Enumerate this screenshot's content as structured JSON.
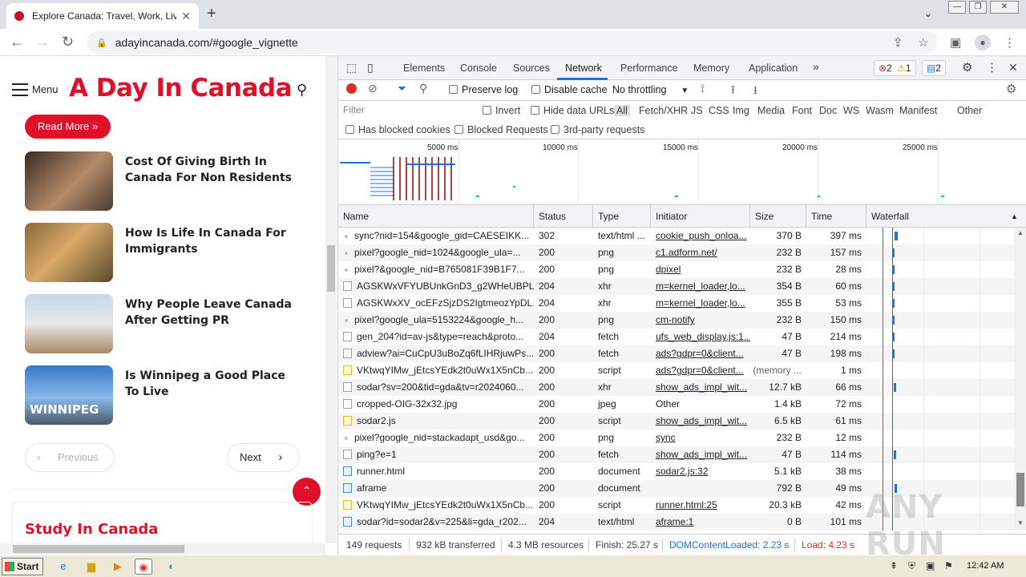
{
  "browser": {
    "tab_title": "Explore Canada: Travel, Work, Live,",
    "url": "adayincanada.com/#google_vignette",
    "new_tab": "+"
  },
  "site": {
    "menu_label": "Menu",
    "title": "A Day In Canada",
    "read_more": "Read More »",
    "posts": [
      {
        "title": "Cost Of Giving Birth In Canada For Non Residents"
      },
      {
        "title": "How Is Life In Canada For Immigrants"
      },
      {
        "title": "Why People Leave Canada After Getting PR"
      },
      {
        "title": "Is Winnipeg a Good Place To Live"
      }
    ],
    "thumb_caption": "WINNIPEG",
    "previous": "Previous",
    "next": "Next",
    "section_title": "Study In Canada"
  },
  "devtools": {
    "tabs": [
      "Elements",
      "Console",
      "Sources",
      "Network",
      "Performance",
      "Memory",
      "Application"
    ],
    "active_tab": "Network",
    "errors": "2",
    "warnings": "1",
    "messages": "2",
    "controls": {
      "preserve_log": "Preserve log",
      "disable_cache": "Disable cache",
      "throttling": "No throttling"
    },
    "filter": {
      "placeholder": "Filter",
      "invert": "Invert",
      "hide_data_urls": "Hide data URLs",
      "types": [
        "All",
        "Fetch/XHR",
        "JS",
        "CSS",
        "Img",
        "Media",
        "Font",
        "Doc",
        "WS",
        "Wasm",
        "Manifest",
        "Other"
      ],
      "has_blocked_cookies": "Has blocked cookies",
      "blocked_requests": "Blocked Requests",
      "third_party": "3rd-party requests"
    },
    "overview_ticks": [
      "5000 ms",
      "10000 ms",
      "15000 ms",
      "20000 ms",
      "25000 ms"
    ],
    "columns": [
      "Name",
      "Status",
      "Type",
      "Initiator",
      "Size",
      "Time",
      "Waterfall"
    ],
    "requests": [
      {
        "icon": "img",
        "name": "sync?nid=154&google_gid=CAESEIKK...",
        "status": "302",
        "type": "text/html ...",
        "initiator": "cookie_push_onloa...",
        "size": "370 B",
        "time": "397 ms"
      },
      {
        "icon": "img",
        "name": "pixel?google_nid=1024&google_ula=...",
        "status": "200",
        "type": "png",
        "initiator": "c1.adform.net/",
        "size": "232 B",
        "time": "157 ms"
      },
      {
        "icon": "img",
        "name": "pixel?&google_nid=B765081F39B1F7...",
        "status": "200",
        "type": "png",
        "initiator": "dpixel",
        "size": "232 B",
        "time": "28 ms"
      },
      {
        "icon": "box",
        "name": "AGSKWxVFYUBUnkGnD3_g2WHeUBPL...",
        "status": "204",
        "type": "xhr",
        "initiator": "m=kernel_loader,lo...",
        "size": "354 B",
        "time": "60 ms"
      },
      {
        "icon": "box",
        "name": "AGSKWxXV_ocEFzSjzDS2IgtmeozYpDL...",
        "status": "204",
        "type": "xhr",
        "initiator": "m=kernel_loader,lo...",
        "size": "355 B",
        "time": "53 ms"
      },
      {
        "icon": "img",
        "name": "pixel?google_ula=5153224&google_h...",
        "status": "200",
        "type": "png",
        "initiator": "cm-notify",
        "size": "232 B",
        "time": "150 ms"
      },
      {
        "icon": "box",
        "name": "gen_204?id=av-js&type=reach&proto...",
        "status": "204",
        "type": "fetch",
        "initiator": "ufs_web_display.js:1...",
        "size": "47 B",
        "time": "214 ms"
      },
      {
        "icon": "box",
        "name": "adview?ai=CuCpU3uBoZq6fLIHRjuwPs...",
        "status": "200",
        "type": "fetch",
        "initiator": "ads?gdpr=0&client...",
        "size": "47 B",
        "time": "198 ms"
      },
      {
        "icon": "scr",
        "name": "VKtwqYIMw_jEtcsYEdk2t0uWx1X5nCb...",
        "status": "200",
        "type": "script",
        "initiator": "ads?gdpr=0&client...",
        "size": "(memory ...",
        "time": "1 ms"
      },
      {
        "icon": "box",
        "name": "sodar?sv=200&tid=gda&tv=r2024060...",
        "status": "200",
        "type": "xhr",
        "initiator": "show_ads_impl_wit...",
        "size": "12.7 kB",
        "time": "66 ms"
      },
      {
        "icon": "box",
        "name": "cropped-OIG-32x32.jpg",
        "status": "200",
        "type": "jpeg",
        "initiator": "Other",
        "size": "1.4 kB",
        "time": "72 ms"
      },
      {
        "icon": "scr",
        "name": "sodar2.js",
        "status": "200",
        "type": "script",
        "initiator": "show_ads_impl_wit...",
        "size": "6.5 kB",
        "time": "61 ms"
      },
      {
        "icon": "img",
        "name": "pixel?google_nid=stackadapt_usd&go...",
        "status": "200",
        "type": "png",
        "initiator": "sync",
        "size": "232 B",
        "time": "12 ms"
      },
      {
        "icon": "box",
        "name": "ping?e=1",
        "status": "200",
        "type": "fetch",
        "initiator": "show_ads_impl_wit...",
        "size": "47 B",
        "time": "114 ms"
      },
      {
        "icon": "doc",
        "name": "runner.html",
        "status": "200",
        "type": "document",
        "initiator": "sodar2.js:32",
        "size": "5.1 kB",
        "time": "38 ms"
      },
      {
        "icon": "doc",
        "name": "aframe",
        "status": "200",
        "type": "document",
        "initiator": "",
        "size": "792 B",
        "time": "49 ms"
      },
      {
        "icon": "scr",
        "name": "VKtwqYIMw_jEtcsYEdk2t0uWx1X5nCb...",
        "status": "200",
        "type": "script",
        "initiator": "runner.html:25",
        "size": "20.3 kB",
        "time": "42 ms"
      },
      {
        "icon": "doc",
        "name": "sodar?id=sodar2&v=225&li=gda_r202...",
        "status": "204",
        "type": "text/html",
        "initiator": "aframe:1",
        "size": "0 B",
        "time": "101 ms"
      }
    ],
    "status": {
      "requests": "149 requests",
      "transferred": "932 kB transferred",
      "resources": "4.3 MB resources",
      "finish": "Finish: 25.27 s",
      "dcl": "DOMContentLoaded: 2.23 s",
      "load": "Load: 4.23 s"
    }
  },
  "watermark": "ANY RUN",
  "taskbar": {
    "start": "Start",
    "clock": "12:42 AM"
  },
  "colors": {
    "brand_red": "#e0102a",
    "devtools_blue": "#1a73e8"
  }
}
